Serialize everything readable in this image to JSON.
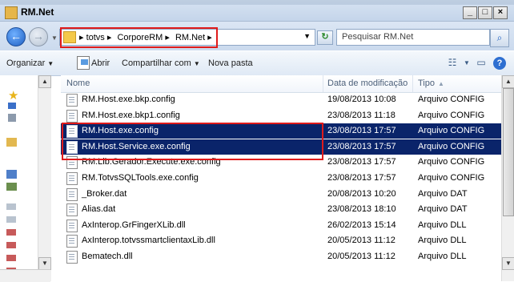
{
  "window": {
    "title": "RM.Net"
  },
  "nav": {
    "back_symbol": "←",
    "forward_symbol": "→"
  },
  "address": {
    "crumbs": [
      "▸ totvs ▸",
      "CorporeRM ▸",
      "RM.Net ▸"
    ],
    "dropdown": "▼",
    "refresh_symbol": "↻"
  },
  "search": {
    "placeholder": "Pesquisar RM.Net",
    "icon": "search-icon"
  },
  "commandbar": {
    "organize": "Organizar",
    "open": "Abrir",
    "share": "Compartilhar com",
    "new_folder": "Nova pasta"
  },
  "columns": {
    "name": "Nome",
    "date": "Data de modificação",
    "type": "Tipo"
  },
  "files": [
    {
      "name": "RM.Host.exe.bkp.config",
      "date": "19/08/2013 10:08",
      "type": "Arquivo CONFIG",
      "selected": false
    },
    {
      "name": "RM.Host.exe.bkp1.config",
      "date": "23/08/2013 11:18",
      "type": "Arquivo CONFIG",
      "selected": false
    },
    {
      "name": "RM.Host.exe.config",
      "date": "23/08/2013 17:57",
      "type": "Arquivo CONFIG",
      "selected": true
    },
    {
      "name": "RM.Host.Service.exe.config",
      "date": "23/08/2013 17:57",
      "type": "Arquivo CONFIG",
      "selected": true
    },
    {
      "name": "RM.Lib.Gerador.Execute.exe.config",
      "date": "23/08/2013 17:57",
      "type": "Arquivo CONFIG",
      "selected": false
    },
    {
      "name": "RM.TotvsSQLTools.exe.config",
      "date": "23/08/2013 17:57",
      "type": "Arquivo CONFIG",
      "selected": false
    },
    {
      "name": "_Broker.dat",
      "date": "20/08/2013 10:20",
      "type": "Arquivo DAT",
      "selected": false
    },
    {
      "name": "Alias.dat",
      "date": "23/08/2013 18:10",
      "type": "Arquivo DAT",
      "selected": false
    },
    {
      "name": "AxInterop.GrFingerXLib.dll",
      "date": "26/02/2013 15:14",
      "type": "Arquivo DLL",
      "selected": false
    },
    {
      "name": "AxInterop.totvssmartclientaxLib.dll",
      "date": "20/05/2013 11:12",
      "type": "Arquivo DLL",
      "selected": false
    },
    {
      "name": "Bematech.dll",
      "date": "20/05/2013 11:12",
      "type": "Arquivo DLL",
      "selected": false
    }
  ],
  "colors": {
    "selection": "#0a246a",
    "highlight": "#e01b1b"
  }
}
